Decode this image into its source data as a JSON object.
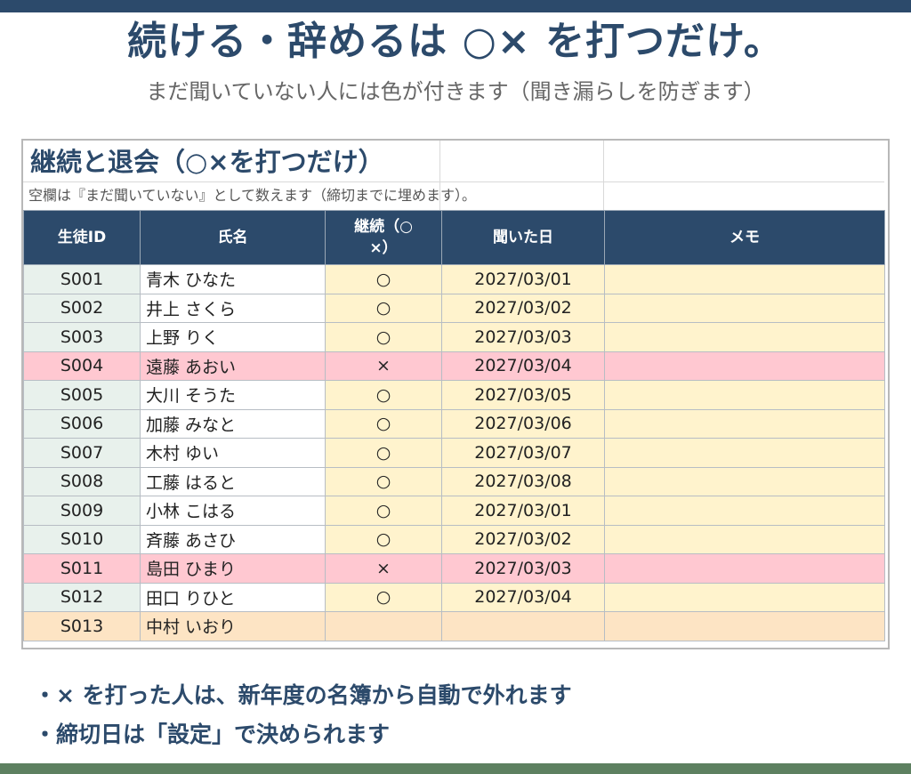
{
  "title": "続ける・辞めるは ○× を打つだけ。",
  "subtitle": "まだ聞いていない人には色が付きます（聞き漏らしを防ぎます）",
  "sheet": {
    "title": "継続と退会（○×を打つだけ）",
    "note": "空欄は『まだ聞いていない』として数えます（締切までに埋めます）。",
    "headers": {
      "id": "生徒ID",
      "name": "氏名",
      "continue_line1": "継続（○",
      "continue_line2": "×）",
      "date": "聞いた日",
      "memo": "メモ"
    },
    "rows": [
      {
        "id": "S001",
        "name": "青木 ひなた",
        "mark": "○",
        "date": "2027/03/01",
        "memo": ""
      },
      {
        "id": "S002",
        "name": "井上 さくら",
        "mark": "○",
        "date": "2027/03/02",
        "memo": ""
      },
      {
        "id": "S003",
        "name": "上野 りく",
        "mark": "○",
        "date": "2027/03/03",
        "memo": ""
      },
      {
        "id": "S004",
        "name": "遠藤 あおい",
        "mark": "×",
        "date": "2027/03/04",
        "memo": ""
      },
      {
        "id": "S005",
        "name": "大川 そうた",
        "mark": "○",
        "date": "2027/03/05",
        "memo": ""
      },
      {
        "id": "S006",
        "name": "加藤 みなと",
        "mark": "○",
        "date": "2027/03/06",
        "memo": ""
      },
      {
        "id": "S007",
        "name": "木村 ゆい",
        "mark": "○",
        "date": "2027/03/07",
        "memo": ""
      },
      {
        "id": "S008",
        "name": "工藤 はると",
        "mark": "○",
        "date": "2027/03/08",
        "memo": ""
      },
      {
        "id": "S009",
        "name": "小林 こはる",
        "mark": "○",
        "date": "2027/03/01",
        "memo": ""
      },
      {
        "id": "S010",
        "name": "斉藤 あさひ",
        "mark": "○",
        "date": "2027/03/02",
        "memo": ""
      },
      {
        "id": "S011",
        "name": "島田 ひまり",
        "mark": "×",
        "date": "2027/03/03",
        "memo": ""
      },
      {
        "id": "S012",
        "name": "田口 りひと",
        "mark": "○",
        "date": "2027/03/04",
        "memo": ""
      },
      {
        "id": "S013",
        "name": "中村 いおり",
        "mark": "",
        "date": "",
        "memo": ""
      }
    ]
  },
  "bullets": [
    "・× を打った人は、新年度の名簿から自動で外れます",
    "・締切日は「設定」で決められます"
  ],
  "colors": {
    "header_bg": "#2c4a6b",
    "id_cell_bg": "#e8f1ec",
    "input_cell_bg": "#fff3cd",
    "declined_row_bg": "#ffc8d1",
    "pending_row_bg": "#fde4c4"
  }
}
